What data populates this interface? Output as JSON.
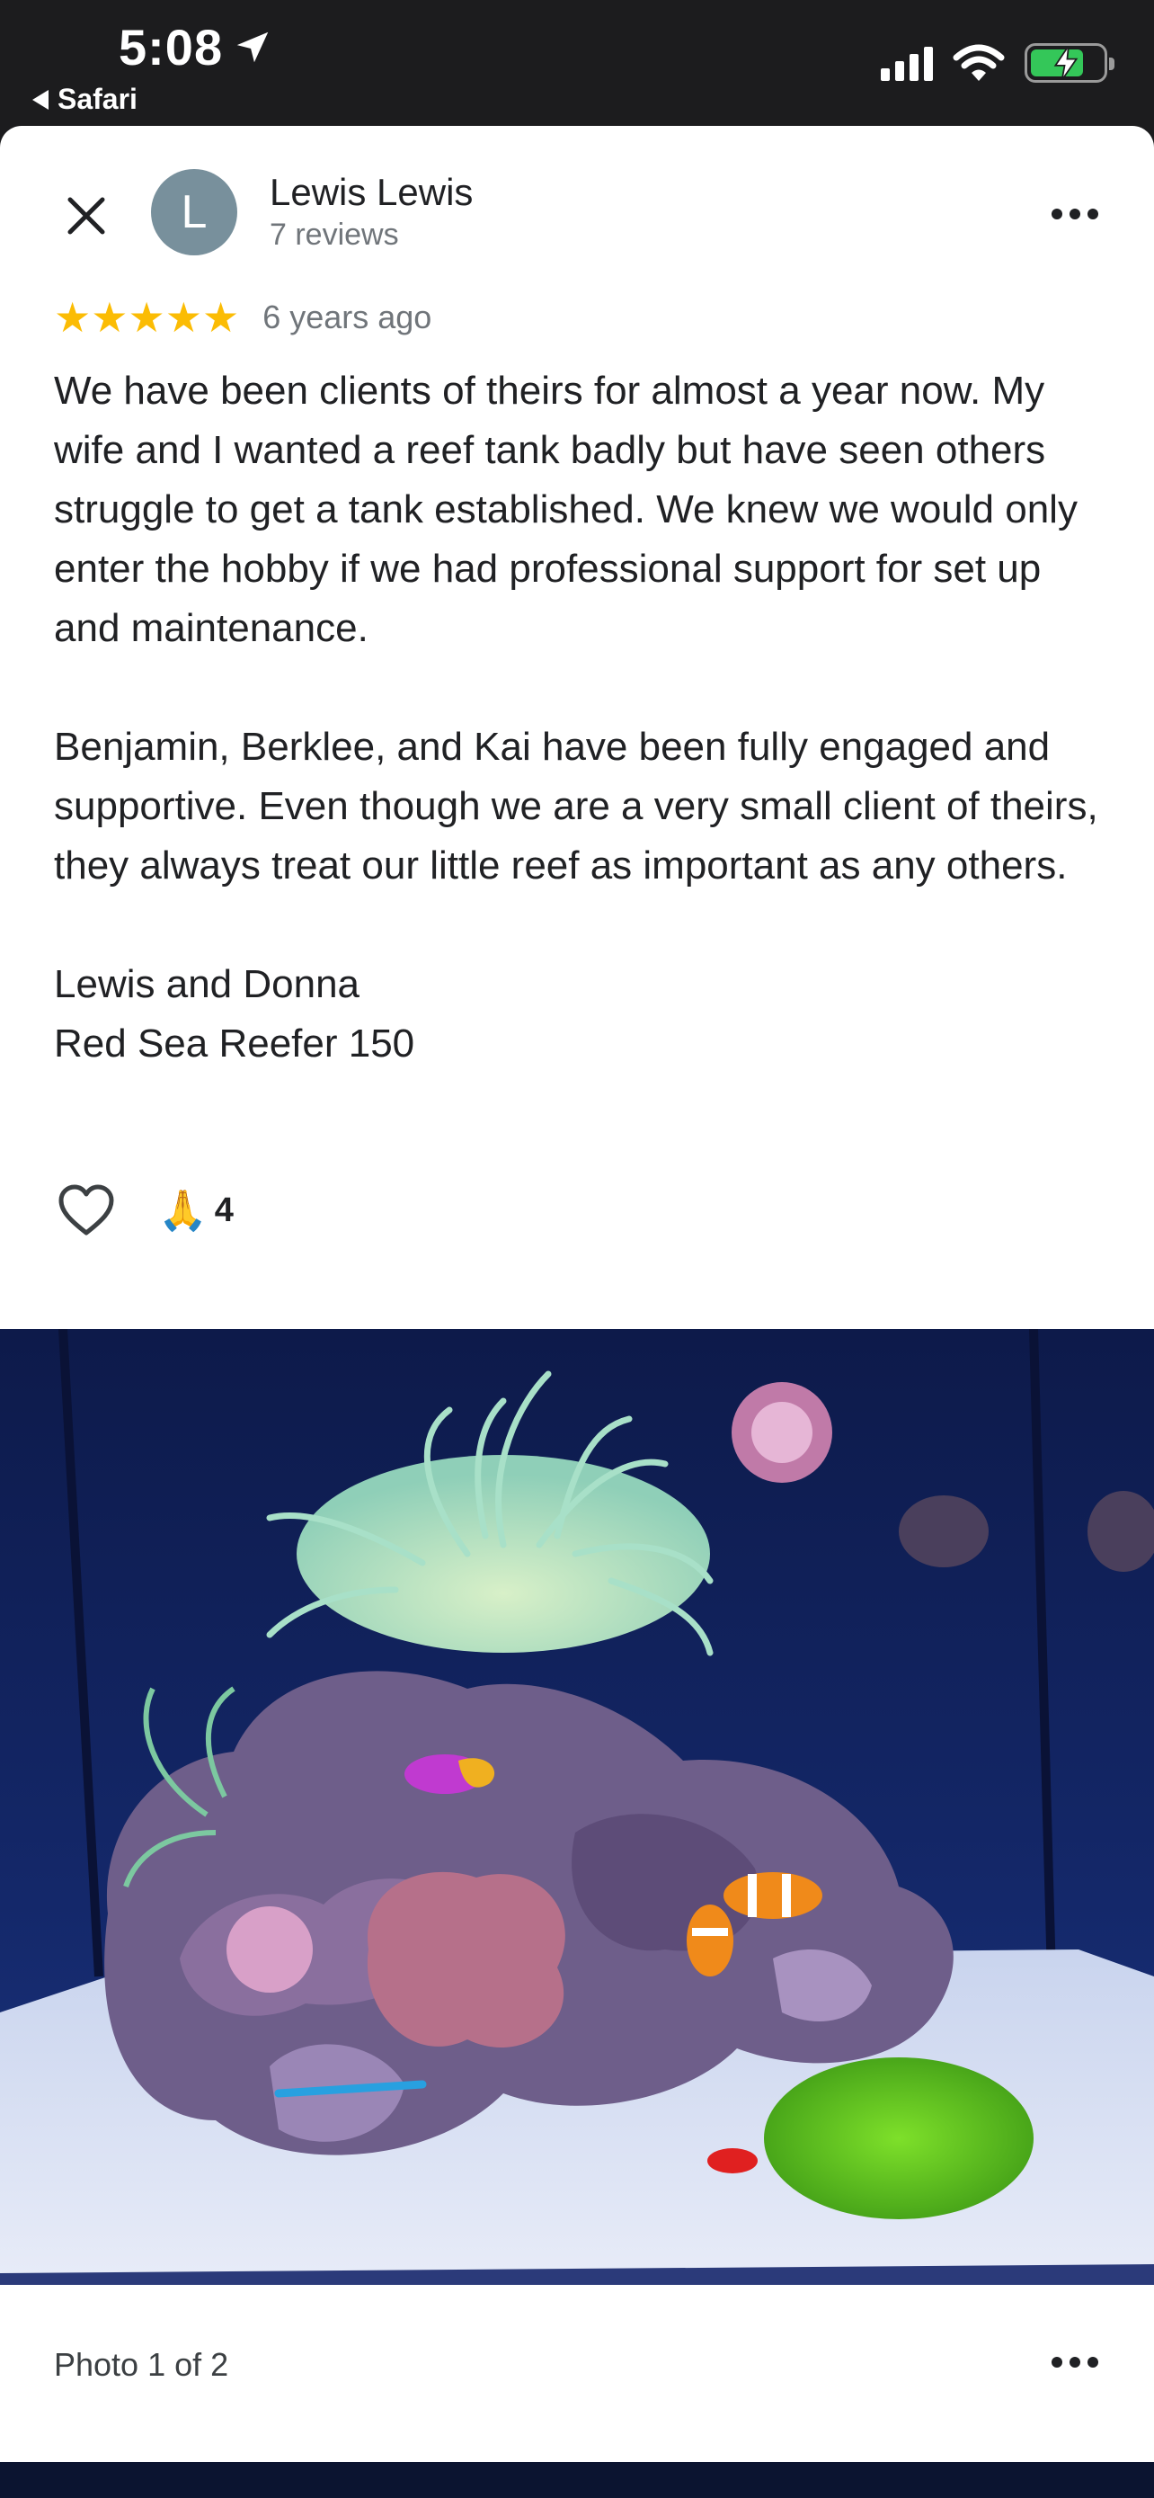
{
  "status_bar": {
    "time": "5:08",
    "back_app": "Safari"
  },
  "review": {
    "avatar_letter": "L",
    "reviewer_name": "Lewis Lewis",
    "review_count": "7 reviews",
    "rating": 5,
    "stars": "★★★★★",
    "age": "6 years ago",
    "paragraphs": [
      "We have been clients of theirs for almost a year now. My wife and I wanted a reef tank badly but have seen others struggle to get a tank established. We knew we would only enter the hobby if we had professional support for set up and maintenance.",
      "Benjamin, Berklee, and Kai have been fully engaged and supportive. Even though we are a very small client of theirs, they always treat our little reef as important as any others.",
      "Lewis and Donna\nRed Sea Reefer 150"
    ],
    "reaction_emoji": "🙏",
    "reaction_count": "4"
  },
  "photo": {
    "counter": "Photo 1 of 2"
  },
  "colors": {
    "star": "#fbbc04",
    "avatar_bg": "#78909c",
    "battery_green": "#34c759"
  },
  "icons": [
    "close-icon",
    "more-icon",
    "heart-icon",
    "location-arrow-icon",
    "signal-icon",
    "wifi-icon",
    "battery-icon"
  ]
}
